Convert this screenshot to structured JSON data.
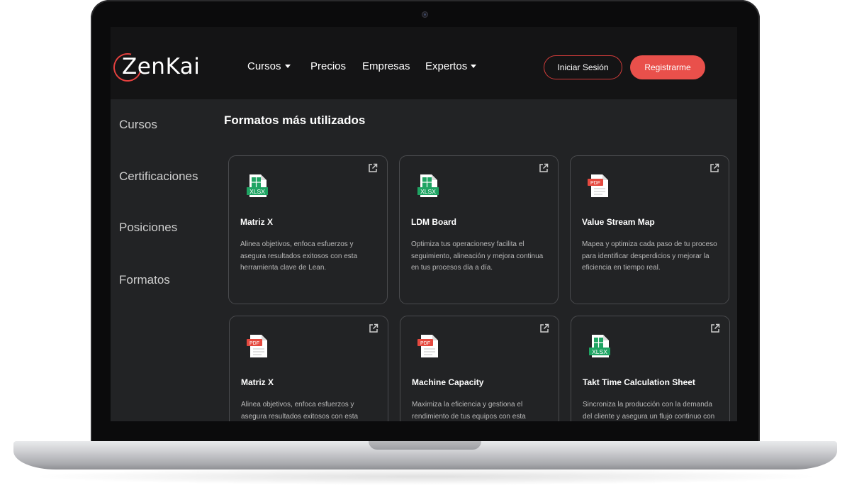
{
  "logo": {
    "text_zen": "Zen",
    "text_kai": "Kai"
  },
  "nav": {
    "items": [
      {
        "label": "Cursos",
        "dropdown": true
      },
      {
        "label": "Precios",
        "dropdown": false
      },
      {
        "label": "Empresas",
        "dropdown": false
      },
      {
        "label": "Expertos",
        "dropdown": true
      }
    ],
    "login_label": "Iniciar Sesión",
    "register_label": "Registrarme"
  },
  "sidebar": {
    "items": [
      {
        "label": "Cursos"
      },
      {
        "label": "Certificaciones"
      },
      {
        "label": "Posiciones"
      },
      {
        "label": "Formatos"
      }
    ]
  },
  "main": {
    "title": "Formatos más utilizados",
    "cards": [
      {
        "title": "Matriz X",
        "file_type": "XLSX",
        "description": "Alinea objetivos, enfoca esfuerzos y asegura resultados exitosos con esta herramienta clave de Lean."
      },
      {
        "title": "LDM Board",
        "file_type": "XLSX",
        "description": "Optimiza tus operacionesy facilita el seguimiento, alineación y mejora continua en tus procesos día a día."
      },
      {
        "title": "Value Stream Map",
        "file_type": "PDF",
        "description": "Mapea y optimiza cada paso de tu proceso para identificar desperdicios y mejorar la eficiencia en tiempo real."
      },
      {
        "title": "Matriz X",
        "file_type": "PDF",
        "description": "Alinea objetivos, enfoca esfuerzos y asegura resultados exitosos con esta"
      },
      {
        "title": "Machine Capacity",
        "file_type": "PDF",
        "description": "Maximiza la eficiencia y gestiona el rendimiento de tus equipos con esta"
      },
      {
        "title": "Takt Time Calculation Sheet",
        "file_type": "XLSX",
        "description": "Sincroniza la producción con la demanda del cliente y asegura un flujo continuo con"
      }
    ]
  },
  "colors": {
    "accent": "#e9504b",
    "xlsx_green": "#1fa463",
    "pdf_red": "#e5493f",
    "background": "#222325",
    "topbar": "#141415"
  },
  "icons": {
    "external": "external-link-icon",
    "xlsx": "xlsx-file-icon",
    "pdf": "pdf-file-icon",
    "caret": "chevron-down-icon"
  }
}
